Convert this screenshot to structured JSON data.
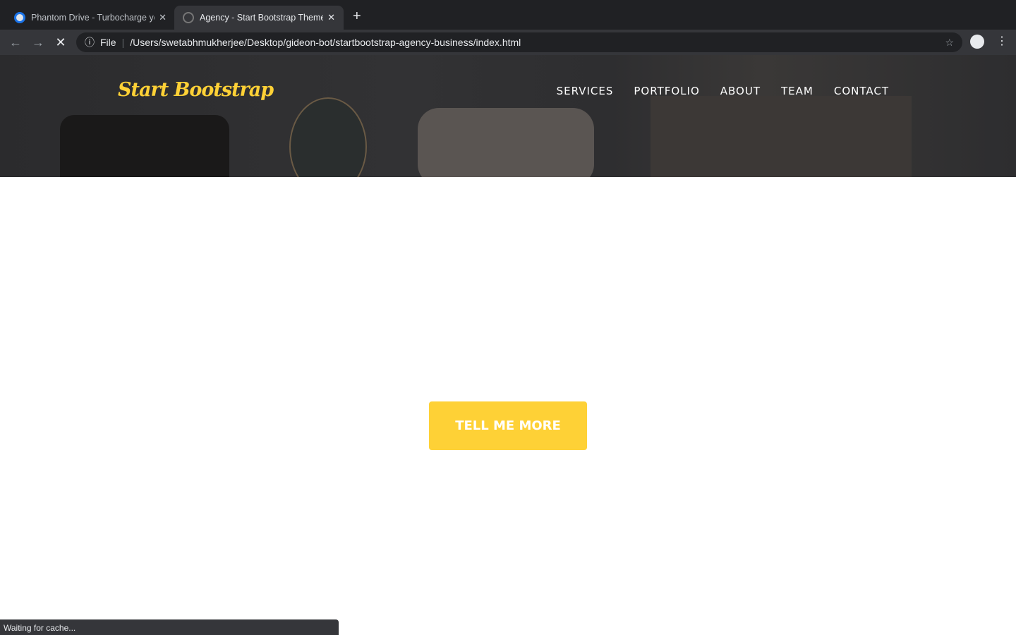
{
  "browser": {
    "tabs": [
      {
        "title": "Phantom Drive - Turbocharge your",
        "active": false
      },
      {
        "title": "Agency - Start Bootstrap Theme",
        "active": true
      }
    ],
    "file_label": "File",
    "url": "/Users/swetabhmukherjee/Desktop/gideon-bot/startbootstrap-agency-business/index.html",
    "status": "Waiting for cache..."
  },
  "site": {
    "brand": "Start Bootstrap",
    "nav": [
      "SERVICES",
      "PORTFOLIO",
      "ABOUT",
      "TEAM",
      "CONTACT"
    ],
    "cta": "TELL ME MORE"
  },
  "colors": {
    "accent": "#fed136"
  }
}
